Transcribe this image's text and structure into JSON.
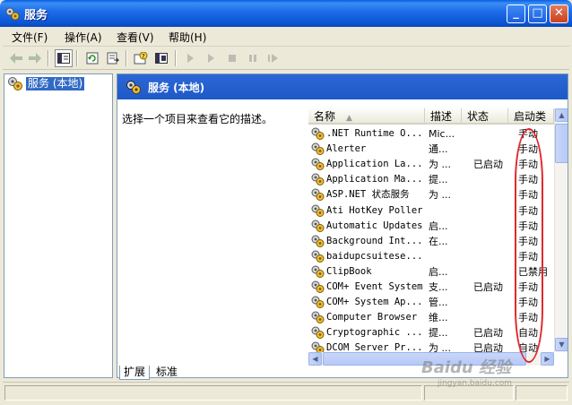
{
  "window": {
    "title": "服务",
    "buttons": {
      "minimize": "_",
      "maximize": "□",
      "close": "✕"
    }
  },
  "menu": [
    "文件(F)",
    "操作(A)",
    "查看(V)",
    "帮助(H)"
  ],
  "toolbar": {
    "icons": [
      "back-arrow-icon",
      "forward-arrow-icon",
      "show-hide-tree-icon",
      "refresh-icon",
      "export-list-icon",
      "help-icon",
      "properties-icon",
      "start-service-icon",
      "start-icon",
      "stop-icon",
      "pause-icon",
      "restart-icon"
    ]
  },
  "tree": {
    "root_label": "服务 (本地)"
  },
  "pane": {
    "header_title": "服务 (本地)",
    "description_hint": "选择一个项目来查看它的描述。"
  },
  "list": {
    "columns": [
      "名称",
      "描述",
      "状态",
      "启动类"
    ],
    "rows": [
      {
        "name": ".NET Runtime O...",
        "desc": "Mic...",
        "status": "",
        "startup": "手动"
      },
      {
        "name": "Alerter",
        "desc": "通...",
        "status": "",
        "startup": "手动"
      },
      {
        "name": "Application La...",
        "desc": "为 ...",
        "status": "已启动",
        "startup": "手动"
      },
      {
        "name": "Application Ma...",
        "desc": "提...",
        "status": "",
        "startup": "手动"
      },
      {
        "name": "ASP.NET 状态服务",
        "desc": "为 ...",
        "status": "",
        "startup": "手动"
      },
      {
        "name": "Ati HotKey Poller",
        "desc": "",
        "status": "",
        "startup": "手动"
      },
      {
        "name": "Automatic Updates",
        "desc": "启...",
        "status": "",
        "startup": "手动"
      },
      {
        "name": "Background Int...",
        "desc": "在...",
        "status": "",
        "startup": "手动"
      },
      {
        "name": "baidupcsuitese...",
        "desc": "",
        "status": "",
        "startup": "手动"
      },
      {
        "name": "ClipBook",
        "desc": "启...",
        "status": "",
        "startup": "已禁用"
      },
      {
        "name": "COM+ Event System",
        "desc": "支...",
        "status": "已启动",
        "startup": "手动"
      },
      {
        "name": "COM+ System Ap...",
        "desc": "管...",
        "status": "",
        "startup": "手动"
      },
      {
        "name": "Computer Browser",
        "desc": "维...",
        "status": "",
        "startup": "手动"
      },
      {
        "name": "Cryptographic ...",
        "desc": "提...",
        "status": "已启动",
        "startup": "自动"
      },
      {
        "name": "DCOM Server Pr...",
        "desc": "为 ...",
        "status": "已启动",
        "startup": "自动"
      }
    ]
  },
  "tabs": [
    "扩展",
    "标准"
  ],
  "watermark": {
    "main": "Baidu 经验",
    "sub": "jingyan.baidu.com"
  },
  "colors": {
    "title_blue": "#0b55d4",
    "selection": "#316ac5",
    "annotation_red": "#e0282e"
  }
}
